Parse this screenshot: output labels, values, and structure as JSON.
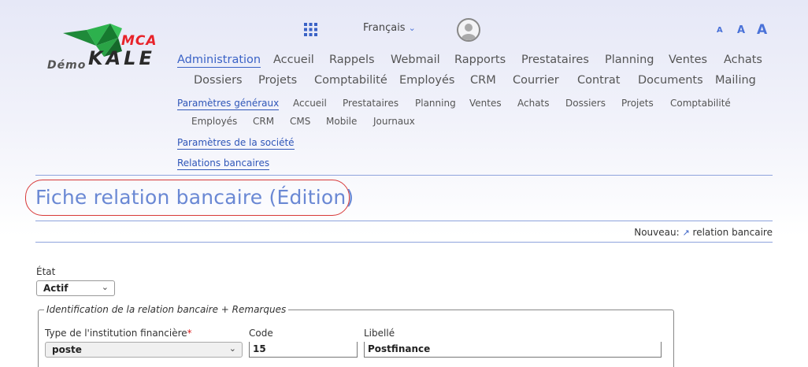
{
  "logo": {
    "demo": "Démo",
    "brand_top": "MCA",
    "brand_main": "KALE"
  },
  "topbar": {
    "language": "Français",
    "font_small": "A",
    "font_medium": "A",
    "font_large": "A"
  },
  "nav": {
    "row1": [
      "Administration",
      "Accueil",
      "Rappels",
      "Webmail",
      "Rapports",
      "Prestataires",
      "Planning",
      "Ventes",
      "Achats"
    ],
    "row2": [
      "Dossiers",
      "Projets",
      "Comptabilité",
      "Employés",
      "CRM",
      "Courrier",
      "Contrat",
      "Documents",
      "Mailing"
    ]
  },
  "subnav": {
    "row1": [
      "Paramètres généraux",
      "Accueil",
      "Prestataires",
      "Planning",
      "Ventes",
      "Achats",
      "Dossiers",
      "Projets",
      "Comptabilité"
    ],
    "row2": [
      "Employés",
      "CRM",
      "CMS",
      "Mobile",
      "Journaux"
    ],
    "company_params": "Paramètres de la société",
    "bank_relations": "Relations bancaires"
  },
  "page": {
    "title": "Fiche relation bancaire (Édition)",
    "new_label": "Nouveau:",
    "new_link": "relation bancaire"
  },
  "form": {
    "state_label": "État",
    "state_value": "Actif",
    "fieldset_legend": "Identification de la relation bancaire + Remarques",
    "institution_type_label": "Type de l'institution financière",
    "required_mark": "*",
    "institution_type_value": "poste",
    "code_label": "Code",
    "code_value": "15",
    "libelle_label": "Libellé",
    "libelle_value": "Postfinance"
  },
  "colors": {
    "accent": "#3a62c6",
    "title": "#6a88d4",
    "brand_red": "#e8232a",
    "highlight_border": "#d83838"
  }
}
